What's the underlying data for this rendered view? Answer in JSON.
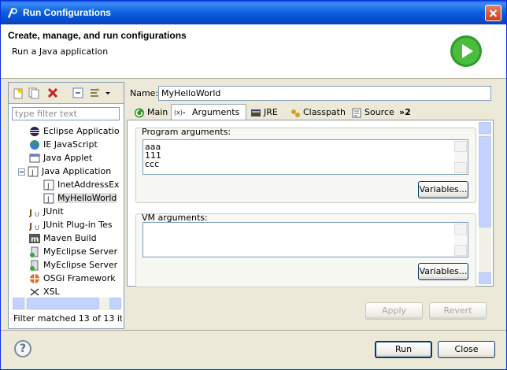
{
  "window": {
    "title": "Run Configurations"
  },
  "banner": {
    "heading": "Create, manage, and run configurations",
    "subtitle": "Run a Java application"
  },
  "left": {
    "filter_placeholder": "type filter text",
    "tree": [
      {
        "label": "Eclipse Applicatio",
        "icon": "eclipse-icon"
      },
      {
        "label": "IE JavaScript",
        "icon": "globe-icon"
      },
      {
        "label": "Java Applet",
        "icon": "applet-icon"
      },
      {
        "label": "Java Application",
        "icon": "java-app-icon"
      },
      {
        "label": "InetAddressEx",
        "icon": "java-app-icon"
      },
      {
        "label": "MyHelloWorld",
        "icon": "java-app-icon"
      },
      {
        "label": "JUnit",
        "icon": "junit-icon"
      },
      {
        "label": "JUnit Plug-in Tes",
        "icon": "junit-plugin-icon"
      },
      {
        "label": "Maven Build",
        "icon": "maven-icon"
      },
      {
        "label": "MyEclipse Server",
        "icon": "server-icon"
      },
      {
        "label": "MyEclipse Server",
        "icon": "server-icon"
      },
      {
        "label": "OSGi Framework",
        "icon": "osgi-icon"
      },
      {
        "label": "XSL",
        "icon": "xsl-icon"
      }
    ],
    "status": "Filter matched 13 of 13 iter"
  },
  "name": {
    "label": "Name:",
    "value": "MyHelloWorld"
  },
  "tabs": [
    {
      "label": "Main"
    },
    {
      "label": "Arguments"
    },
    {
      "label": "JRE"
    },
    {
      "label": "Classpath"
    },
    {
      "label": "Source"
    },
    {
      "label": "»2"
    }
  ],
  "arguments": {
    "program_label": "Program arguments:",
    "program_value": "aaa\n111\nccc",
    "vm_label": "VM arguments:",
    "vm_value": "",
    "variables_label": "Variables..."
  },
  "actions": {
    "apply": "Apply",
    "revert": "Revert",
    "run": "Run",
    "close": "Close",
    "help": "?"
  }
}
